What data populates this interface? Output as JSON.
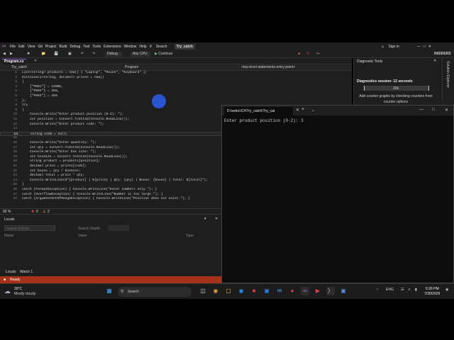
{
  "menu": {
    "items": [
      "File",
      "Edit",
      "View",
      "Git",
      "Project",
      "Build",
      "Debug",
      "Test",
      "Tools",
      "Extensions",
      "Window",
      "Help"
    ],
    "search": "Search",
    "solution": "Try_catch",
    "signin": "Sign in",
    "insiders": "INSIDERS"
  },
  "toolbar": {
    "config": "Debug",
    "platform": "Any CPU",
    "continue": "Continue"
  },
  "editor": {
    "tab": "Program.cs",
    "nav_project": "Try_catch",
    "nav_class": "Program",
    "nav_member": "<top-level-statements-entry-point>",
    "zoom": "92 %",
    "errors": "0",
    "warnings": "2",
    "lines": [
      {
        "n": "1",
        "t": "List<string> products = new() { \"Laptop\", \"Mouse\", \"Keyboard\" };"
      },
      {
        "n": "2",
        "t": "Dictionary<string, decimal> prices = new()"
      },
      {
        "n": "3",
        "t": "{"
      },
      {
        "n": "4",
        "t": "    [\"P001\"] = 1200m,"
      },
      {
        "n": "5",
        "t": "    [\"P002\"] = 25m,"
      },
      {
        "n": "6",
        "t": "    [\"P003\"] = 45m"
      },
      {
        "n": "7",
        "t": "};"
      },
      {
        "n": "8",
        "t": "try"
      },
      {
        "n": "9",
        "t": "{"
      },
      {
        "n": "10",
        "t": "    Console.Write(\"Enter product position (0-2): \");"
      },
      {
        "n": "11",
        "t": "    int position = Convert.ToInt32(Console.ReadLine());"
      },
      {
        "n": "12",
        "t": "    Console.Write(\"Enter product code: \");"
      },
      {
        "n": "13",
        "t": ""
      },
      {
        "n": "14",
        "t": "    string code = null;"
      },
      {
        "n": "15",
        "t": ""
      },
      {
        "n": "16",
        "t": "    Console.Write(\"Enter quantity: \");"
      },
      {
        "n": "17",
        "t": "    int qty = Convert.ToInt32(Console.ReadLine());"
      },
      {
        "n": "18",
        "t": "    Console.Write(\"Enter box size: \");"
      },
      {
        "n": "19",
        "t": "    int boxSize = Convert.ToInt32(Console.ReadLine());"
      },
      {
        "n": "20",
        "t": "    string product = products[position];"
      },
      {
        "n": "21",
        "t": "    decimal price = prices[code];"
      },
      {
        "n": "22",
        "t": "    int boxes = qty / boxSize;"
      },
      {
        "n": "23",
        "t": "    decimal total = price * qty;"
      },
      {
        "n": "24",
        "t": "    Console.WriteLine($\"{product} | ${price} | Qty: {qty} | Boxes: {boxes} | Total: ${total}\");"
      },
      {
        "n": "25",
        "t": "}"
      },
      {
        "n": "26",
        "t": "catch (FormatException) { Console.WriteLine(\"Enter numbers only.\"); }"
      },
      {
        "n": "27",
        "t": "catch (OverflowException) { Console.WriteLine(\"Number is too large.\"); }"
      },
      {
        "n": "28",
        "t": "catch (ArgumentOutOfRangeException) { Console.WriteLine(\"Position does not exist.\"); }"
      }
    ]
  },
  "locals": {
    "title": "Locals",
    "search_placeholder": "Search (Ctrl+E)",
    "search_depth": "Search Depth:",
    "col_name": "Name",
    "col_value": "Value",
    "col_type": "Type",
    "tabs": [
      "Locals",
      "Watch 1"
    ]
  },
  "status": {
    "text": "Ready"
  },
  "diagnostics": {
    "title": "Diagnostic Tools",
    "session": "Diagnostics session: 12 seconds",
    "tick": "10s",
    "hint": "Add counter graphs by checking counters from counter options",
    "side_tab": "Solution Explorer"
  },
  "console": {
    "tab_title": "D:\\setec\\C#\\Try_catch\\Try_cat",
    "text": "Enter product position (0-2): 3"
  },
  "taskbar": {
    "temp": "30°C",
    "weather": "Mostly cloudy",
    "search": "Search",
    "lang": "ENG",
    "time": "6:26 PM",
    "date": "7/30/2026"
  }
}
